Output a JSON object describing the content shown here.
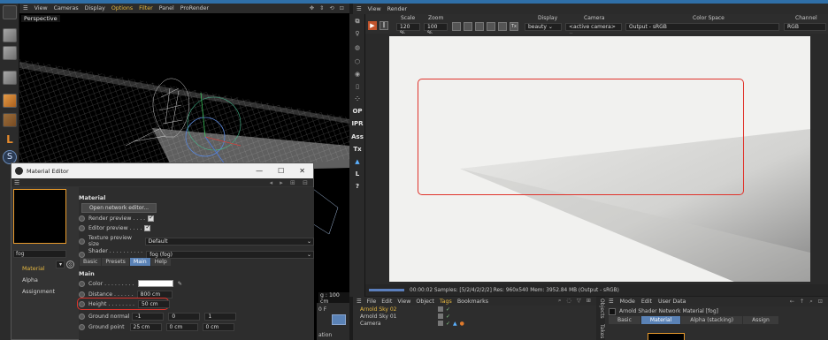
{
  "viewport": {
    "menu": [
      "View",
      "Cameras",
      "Display",
      "Options",
      "Filter",
      "Panel",
      "ProRender"
    ],
    "label": "Perspective",
    "hud_text": "g : 100 cm",
    "right_labels": [
      "0 F",
      "ation"
    ]
  },
  "left_toolbar": {
    "icons": [
      "cube-tool-icon",
      "nurbs-tool-icon",
      "cube-tool-icon",
      "generator-tool-icon",
      "deformer-tool-icon",
      "l-tool-icon",
      "sketch-tool-icon"
    ]
  },
  "material_editor": {
    "title": "Material Editor",
    "window_controls": [
      "—",
      "☐",
      "✕"
    ],
    "name_field": "fog",
    "nav": [
      "Material",
      "Alpha",
      "Assignment"
    ],
    "active_nav": "Material",
    "section_material": "Material",
    "open_network_button": "Open network editor...",
    "render_preview_label": "Render preview . . . .",
    "editor_preview_label": "Editor preview . . . .",
    "texture_preview_label": "Texture preview size",
    "texture_preview_value": "Default",
    "shader_label": "Shader . . . . . . . . . . .",
    "shader_value": "fog (fog)",
    "tabs": [
      "Basic",
      "Presets",
      "Main",
      "Help"
    ],
    "active_tab": "Main",
    "section_main": "Main",
    "color_label": "Color . . . . . . . . .",
    "distance_label": "Distance . . . . . .",
    "distance_value": "800 cm",
    "height_label": "Height . . . . . . . .",
    "height_value": "50 cm",
    "ground_normal_label": "Ground normal",
    "ground_normal_values": [
      "-1",
      "0",
      "1"
    ],
    "ground_point_label": "Ground point",
    "ground_point_values": [
      "25 cm",
      "0 cm",
      "0 cm"
    ]
  },
  "render_view": {
    "menu": [
      "View",
      "Render"
    ],
    "toolbar_labels": {
      "scale": "Scale",
      "scale_value": "120 %",
      "zoom": "Zoom",
      "zoom_value": "100 %",
      "display": "Display",
      "display_value": "beauty",
      "camera": "Camera",
      "camera_value": "<active camera>",
      "color_space": "Color Space",
      "color_space_value": "Output - sRGB",
      "channel": "Channel",
      "channel_value": "RGB"
    },
    "side_buttons": [
      "OP",
      "IPR",
      "Ass",
      "Tx",
      "L",
      "?"
    ],
    "status": "00:00:02  Samples: [5/2/4/2/2/2]  Res: 960x540  Mem: 3952.84 MB  (Output - sRGB)"
  },
  "object_manager": {
    "menu": [
      "File",
      "Edit",
      "View",
      "Object",
      "Tags",
      "Bookmarks"
    ],
    "highlighted_menu": "Tags",
    "objects": [
      {
        "name": "Arnold Sky 02",
        "selected": true
      },
      {
        "name": "Arnold Sky 01",
        "selected": false
      },
      {
        "name": "Camera",
        "selected": false
      }
    ],
    "side_tabs": [
      "Objects",
      "Takes"
    ]
  },
  "attribute_manager": {
    "menu": [
      "Mode",
      "Edit",
      "User Data"
    ],
    "title": "Arnold Shader Network Material [fog]",
    "tabs": [
      "Basic",
      "Material",
      "Alpha (stacking)",
      "Assign"
    ],
    "active_tab": "Material"
  },
  "colors": {
    "accent_orange": "#e89a2c",
    "highlight_yellow": "#e6b840",
    "tab_blue": "#5a82b6",
    "annotation_red": "#e0332b"
  }
}
